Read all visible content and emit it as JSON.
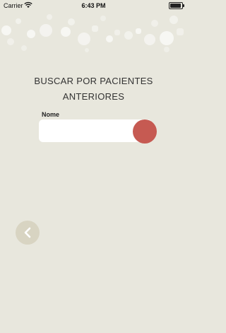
{
  "status_bar": {
    "carrier": "Carrier",
    "time": "6:43 PM",
    "icons": [
      "wifi-icon",
      "battery-icon"
    ]
  },
  "main": {
    "title_line1": "BUSCAR POR PACIENTES",
    "title_line2": "ANTERIORES",
    "name_label": "Nome",
    "name_value": "",
    "name_placeholder": ""
  },
  "buttons": {
    "search": {
      "icon": "search-button",
      "color": "#c65a52"
    },
    "back": {
      "icon": "chevron-left-icon",
      "color": "#d8d4c2"
    }
  },
  "colors": {
    "background": "#e8e7dd",
    "input_background": "#ffffff",
    "text": "#333333"
  }
}
